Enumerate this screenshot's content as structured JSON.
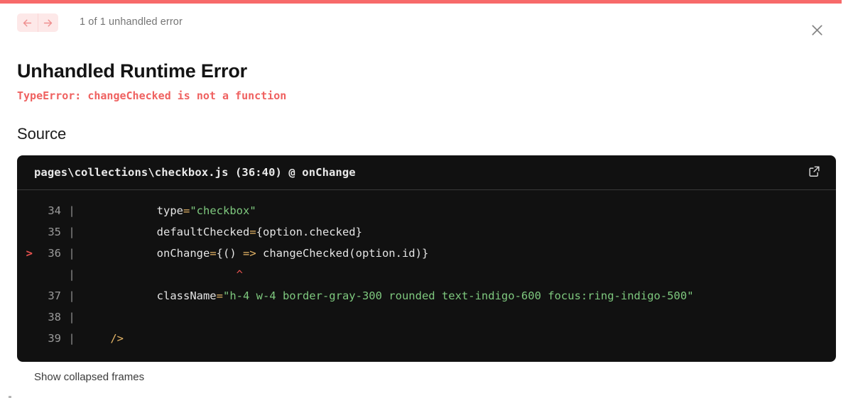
{
  "overlay": {
    "accent_color": "#f76a6a",
    "nav": {
      "prev_icon": "arrow-left-icon",
      "next_icon": "arrow-right-icon",
      "count_label": "1 of 1 unhandled error"
    },
    "close_icon": "close-icon",
    "title": "Unhandled Runtime Error",
    "error_message": "TypeError: changeChecked is not a function",
    "source_heading": "Source",
    "show_collapsed_frames_label": "Show collapsed frames"
  },
  "code_card": {
    "file_header": "pages\\collections\\checkbox.js (36:40) @ onChange",
    "open_in_editor_icon": "external-link-icon",
    "background": "#111111",
    "lines": [
      {
        "number": "34",
        "marker": "",
        "bar": "|",
        "tokens": [
          {
            "t": "        type",
            "c": "plain"
          },
          {
            "t": "=",
            "c": "op"
          },
          {
            "t": "\"checkbox\"",
            "c": "string"
          }
        ]
      },
      {
        "number": "35",
        "marker": "",
        "bar": "|",
        "tokens": [
          {
            "t": "        defaultChecked",
            "c": "plain"
          },
          {
            "t": "=",
            "c": "op"
          },
          {
            "t": "{option.checked}",
            "c": "plain"
          }
        ]
      },
      {
        "number": "36",
        "marker": ">",
        "bar": "|",
        "tokens": [
          {
            "t": "        onChange",
            "c": "plain"
          },
          {
            "t": "=",
            "c": "op"
          },
          {
            "t": "{() ",
            "c": "plain"
          },
          {
            "t": "=>",
            "c": "op"
          },
          {
            "t": " changeChecked(option.id)}",
            "c": "plain"
          }
        ]
      },
      {
        "number": "",
        "marker": "",
        "bar": "|",
        "tokens": [
          {
            "t": "                    ^",
            "c": "caret"
          }
        ]
      },
      {
        "number": "37",
        "marker": "",
        "bar": "|",
        "tokens": [
          {
            "t": "        className",
            "c": "plain"
          },
          {
            "t": "=",
            "c": "op"
          },
          {
            "t": "\"h-4 w-4 border-gray-300 rounded text-indigo-600 focus:ring-indigo-500\"",
            "c": "string"
          }
        ]
      },
      {
        "number": "38",
        "marker": "",
        "bar": "|",
        "tokens": []
      },
      {
        "number": "39",
        "marker": "",
        "bar": "|",
        "tokens": [
          {
            "t": " ",
            "c": "plain"
          },
          {
            "t": "/>",
            "c": "punct"
          }
        ]
      }
    ]
  }
}
